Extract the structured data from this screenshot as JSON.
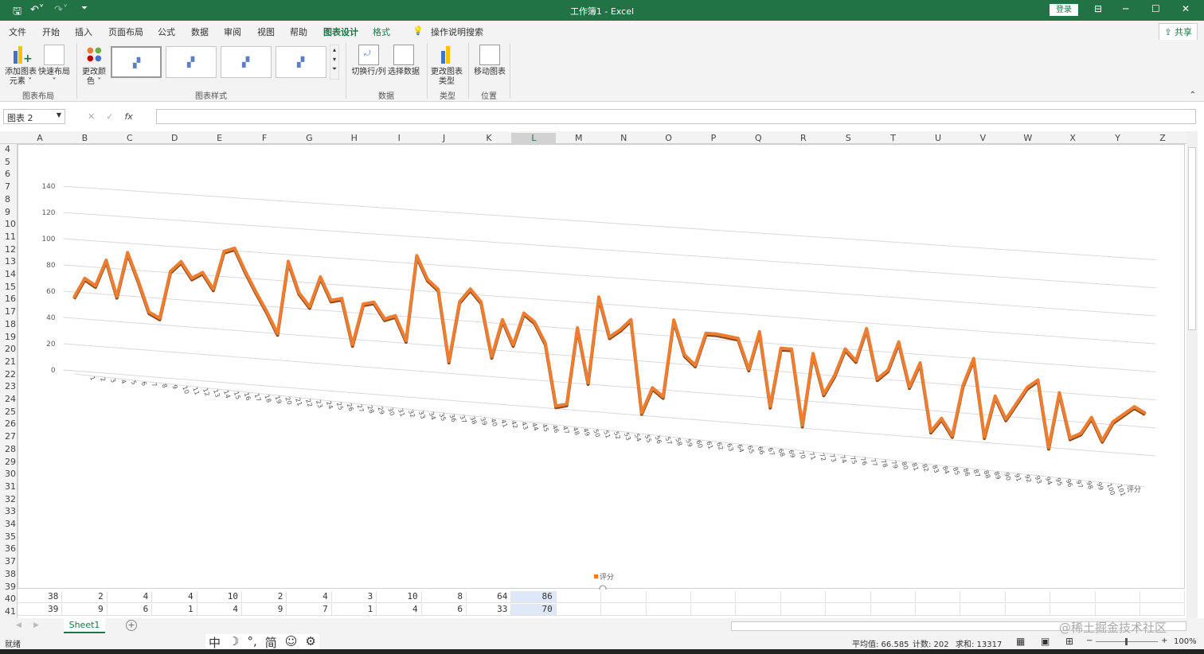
{
  "window": {
    "title": "工作簿1 - Excel",
    "login": "登录",
    "minimize": "─",
    "maximize": "☐",
    "close": "✕",
    "ribbon_display": "⊟"
  },
  "menu": {
    "items": [
      "文件",
      "开始",
      "插入",
      "页面布局",
      "公式",
      "数据",
      "审阅",
      "视图",
      "帮助",
      "图表设计",
      "格式"
    ],
    "active": "图表设计",
    "search": "操作说明搜索",
    "share": "共享"
  },
  "ribbon": {
    "add_element": "添加图表元素",
    "quick_layout": "快速布局",
    "change_colors": "更改颜色",
    "switch_row_col": "切换行/列",
    "select_data": "选择数据",
    "change_type": "更改图表类型",
    "move_chart": "移动图表",
    "groups": {
      "layout": "图表布局",
      "styles": "图表样式",
      "data": "数据",
      "type": "类型",
      "location": "位置"
    }
  },
  "formula_bar": {
    "name_box": "图表 2",
    "cancel": "✕",
    "enter": "✓",
    "fx": "fx",
    "value": ""
  },
  "columns": [
    "A",
    "B",
    "C",
    "D",
    "E",
    "F",
    "G",
    "H",
    "I",
    "J",
    "K",
    "L",
    "M",
    "N",
    "O",
    "P",
    "Q",
    "R",
    "S",
    "T",
    "U",
    "V",
    "W",
    "X",
    "Y",
    "Z"
  ],
  "rows": [
    4,
    5,
    6,
    7,
    8,
    9,
    10,
    11,
    12,
    13,
    14,
    15,
    16,
    17,
    18,
    19,
    20,
    21,
    22,
    23,
    24,
    25,
    26,
    27,
    28,
    29,
    30,
    31,
    32,
    33,
    34,
    35,
    36,
    37,
    38,
    39,
    40,
    41
  ],
  "cells": {
    "row40": [
      "38",
      "2",
      "4",
      "4",
      "10",
      "2",
      "4",
      "3",
      "10",
      "8",
      "64",
      "86"
    ],
    "row41": [
      "39",
      "9",
      "6",
      "1",
      "4",
      "9",
      "7",
      "1",
      "4",
      "6",
      "33",
      "70"
    ]
  },
  "selected_column": "L",
  "sheet_tabs": {
    "items": [
      "Sheet1"
    ],
    "add": "+"
  },
  "ime": {
    "items": [
      "中",
      "☽",
      "°,",
      "简",
      "☺",
      "⚙"
    ]
  },
  "status": {
    "ready": "就绪",
    "average": "平均值: 66.585",
    "count": "计数: 202",
    "sum": "求和: 13317",
    "zoom": "100%",
    "watermark": "@稀土掘金技术社区"
  },
  "chart_data": {
    "type": "line",
    "title": "",
    "series": [
      {
        "name": "评分",
        "color": "#ed7d31",
        "values": [
          56,
          71,
          66,
          86,
          59,
          93,
          72,
          49,
          45,
          81,
          89,
          77,
          82,
          70,
          99,
          102,
          85,
          70,
          56,
          40,
          95,
          72,
          62,
          85,
          68,
          70,
          36,
          67,
          69,
          57,
          60,
          42,
          106,
          89,
          82,
          29,
          74,
          84,
          75,
          35,
          63,
          45,
          69,
          63,
          48,
          2,
          4,
          61,
          21,
          85,
          56,
          62,
          70,
          2,
          21,
          15,
          72,
          47,
          40,
          64,
          64,
          63,
          62,
          40,
          68,
          14,
          57,
          57,
          2,
          55,
          26,
          40,
          60,
          52,
          76,
          40,
          47,
          68,
          36,
          54,
          5,
          15,
          3,
          40,
          60,
          4,
          34,
          18,
          30,
          42,
          48,
          0,
          40,
          8,
          12,
          24,
          8,
          22,
          28,
          34,
          30
        ]
      }
    ],
    "x": [
      1,
      2,
      3,
      4,
      5,
      6,
      7,
      8,
      9,
      10,
      11,
      12,
      13,
      14,
      15,
      16,
      17,
      18,
      19,
      20,
      21,
      22,
      23,
      24,
      25,
      26,
      27,
      28,
      29,
      30,
      31,
      32,
      33,
      34,
      35,
      36,
      37,
      38,
      39,
      40,
      41,
      42,
      43,
      44,
      45,
      46,
      47,
      48,
      49,
      50,
      51,
      52,
      53,
      54,
      55,
      56,
      57,
      58,
      59,
      60,
      61,
      62,
      63,
      64,
      65,
      66,
      67,
      68,
      69,
      70,
      71,
      72,
      73,
      74,
      75,
      76,
      77,
      78,
      79,
      80,
      81,
      82,
      83,
      84,
      85,
      86,
      87,
      88,
      89,
      90,
      91,
      92,
      93,
      94,
      95,
      96,
      97,
      98,
      99,
      100,
      101
    ],
    "y_ticks": [
      "0",
      "20",
      "40",
      "60",
      "80",
      "100",
      "120",
      "140"
    ],
    "ylim": [
      0,
      140
    ],
    "depth_axis_label": "评分",
    "legend": "评分",
    "legend_position": "bottom",
    "grid": true
  }
}
